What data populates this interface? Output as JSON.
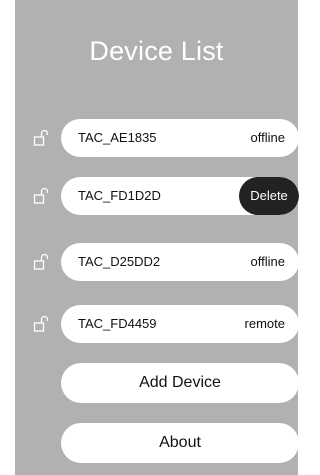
{
  "app": {
    "title": "Device List"
  },
  "devices": [
    {
      "name": "TAC_AE1835",
      "status": "offline",
      "icon": "unlocked-padlock-icon"
    },
    {
      "name": "TAC_FD1D2D",
      "status": "",
      "icon": "unlocked-padlock-icon",
      "swipe_action": "Delete"
    },
    {
      "name": "TAC_D25DD2",
      "status": "offline",
      "icon": "unlocked-padlock-icon"
    },
    {
      "name": "TAC_FD4459",
      "status": "remote",
      "icon": "unlocked-padlock-icon"
    }
  ],
  "actions": {
    "add_device": "Add Device",
    "about": "About"
  },
  "colors": {
    "panel_background": "#b1b1b1",
    "title_text": "#ffffff",
    "pill_background": "#ffffff",
    "delete_background": "#222222",
    "delete_text": "#ffffff"
  }
}
